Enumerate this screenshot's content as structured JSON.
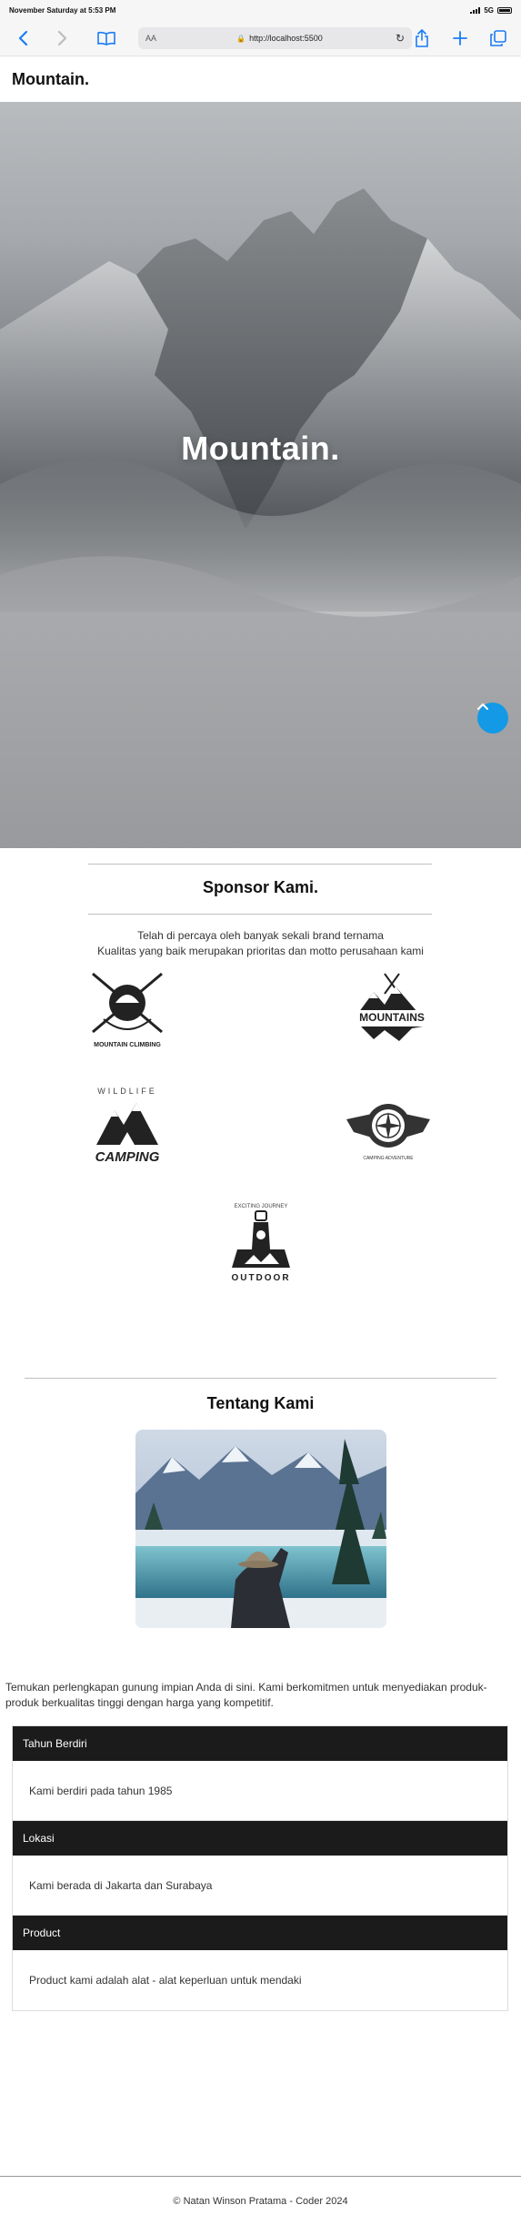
{
  "statusbar": {
    "time": "November Saturday at 5:53 PM",
    "network": "5G"
  },
  "browser": {
    "text_size_label": "AA",
    "url": "http://localhost:5500",
    "icons": [
      "back-icon",
      "forward-icon",
      "bookmarks-icon",
      "lock-icon",
      "reload-icon",
      "share-icon",
      "new-tab-icon",
      "tabs-icon"
    ]
  },
  "nav": {
    "brand": "Mountain."
  },
  "hero": {
    "title": "Mountain.",
    "scroll_top_icon": "chevron-up-icon"
  },
  "sponsor": {
    "title": "Sponsor Kami.",
    "line1": "Telah di percaya oleh banyak sekali brand ternama",
    "line2": "Kualitas yang baik merupakan prioritas dan motto perusahaan kami",
    "logos": [
      {
        "name": "MOUNTAIN CLIMBING"
      },
      {
        "name": "MOUNTAINS"
      },
      {
        "name": "CAMPING",
        "sub": "WILDLIFE"
      },
      {
        "name": "CAMPING ADVENTURE"
      },
      {
        "name": "OUTDOOR",
        "sub": "EXCITING JOURNEY"
      }
    ]
  },
  "about": {
    "title": "Tentang Kami",
    "text": "Temukan perlengkapan gunung impian Anda di sini. Kami berkomitmen untuk menyediakan produk-produk berkualitas tinggi dengan harga yang kompetitif.",
    "items": [
      {
        "heading": "Tahun Berdiri",
        "body": "Kami berdiri pada tahun 1985"
      },
      {
        "heading": "Lokasi",
        "body": "Kami berada di Jakarta dan Surabaya"
      },
      {
        "heading": "Product",
        "body": "Product kami adalah alat - alat keperluan untuk mendaki"
      }
    ]
  },
  "footer": {
    "text": "© Natan Winson Pratama - Coder 2024"
  }
}
